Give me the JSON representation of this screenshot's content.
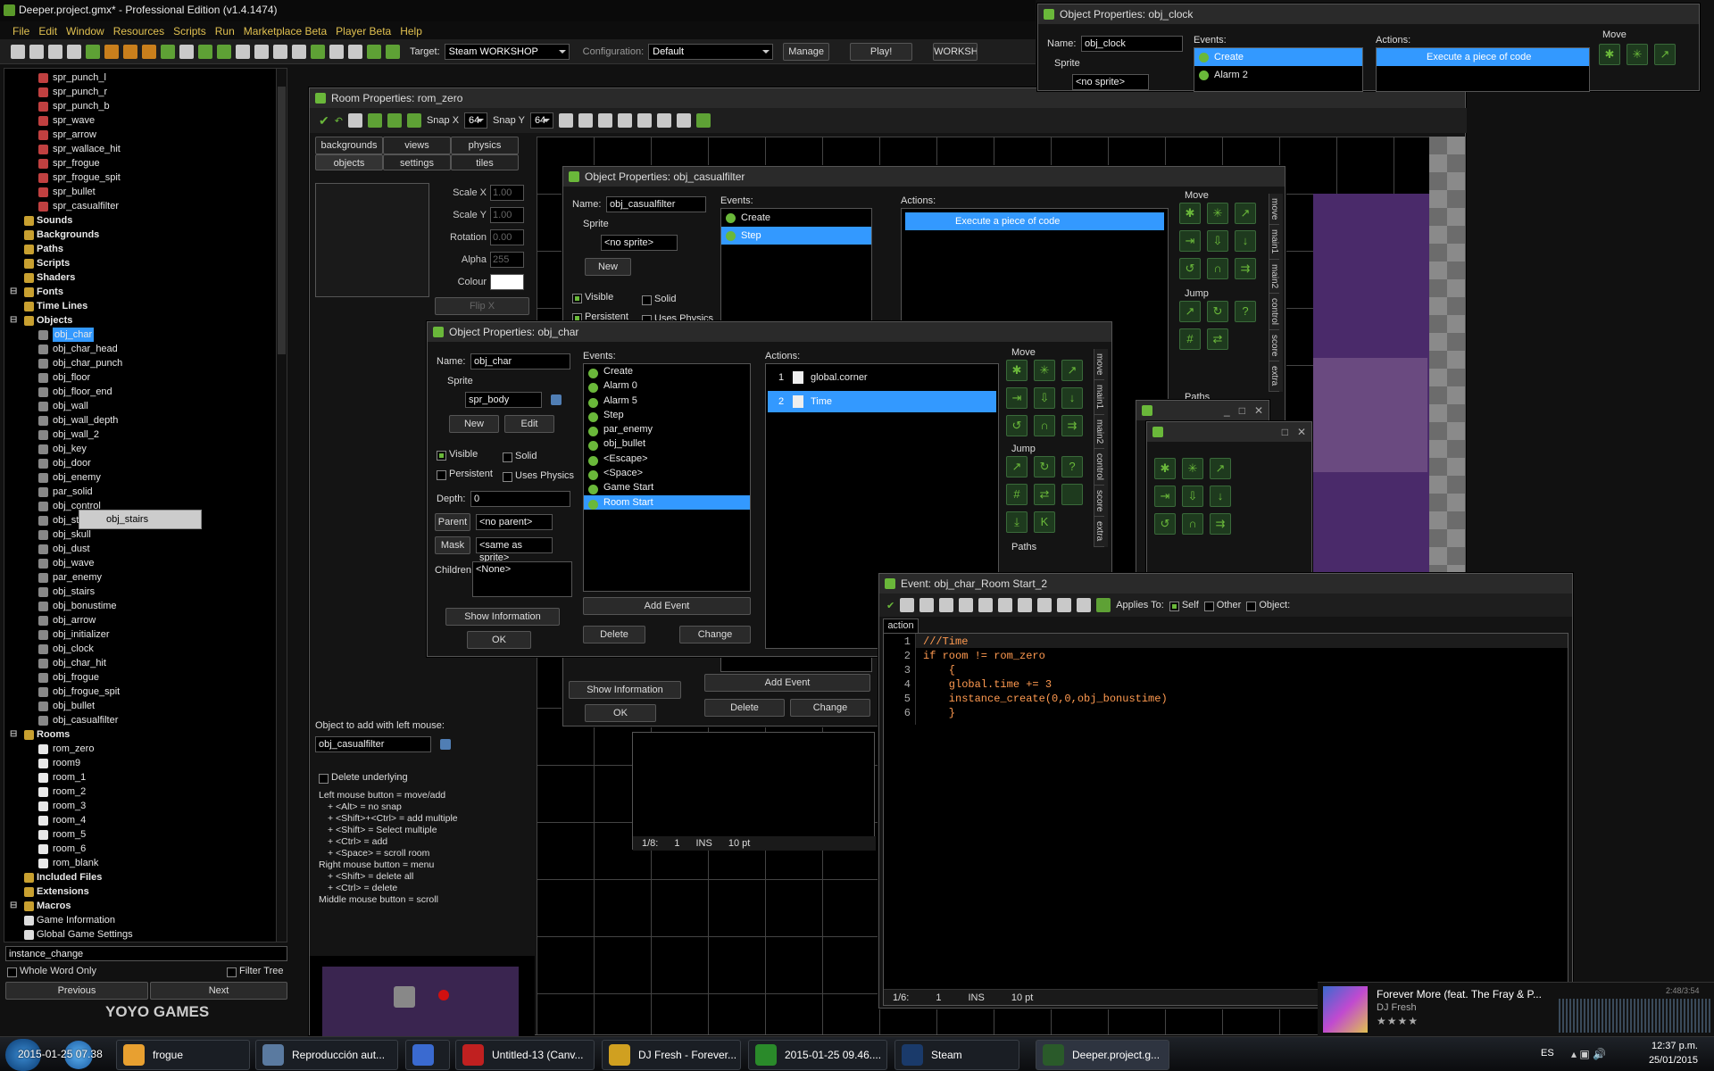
{
  "app": {
    "title": "Deeper.project.gmx* - Professional Edition (v1.4.1474)"
  },
  "menu": [
    "File",
    "Edit",
    "Window",
    "Resources",
    "Scripts",
    "Run",
    "Marketplace Beta",
    "Player Beta",
    "Help"
  ],
  "toolbar": {
    "target_label": "Target:",
    "target_value": "Steam WORKSHOP",
    "config_label": "Configuration:",
    "config_value": "Default",
    "manage": "Manage",
    "play": "Play!",
    "workshop": "WORKSHOP"
  },
  "tree": {
    "items": [
      {
        "name": "spr_punch_l",
        "type": "sprite",
        "indent": 2
      },
      {
        "name": "spr_punch_r",
        "type": "sprite",
        "indent": 2
      },
      {
        "name": "spr_punch_b",
        "type": "sprite",
        "indent": 2
      },
      {
        "name": "spr_wave",
        "type": "sprite",
        "indent": 2
      },
      {
        "name": "spr_arrow",
        "type": "sprite",
        "indent": 2
      },
      {
        "name": "spr_wallace_hit",
        "type": "sprite",
        "indent": 2
      },
      {
        "name": "spr_frogue",
        "type": "sprite",
        "indent": 2
      },
      {
        "name": "spr_frogue_spit",
        "type": "sprite",
        "indent": 2
      },
      {
        "name": "spr_bullet",
        "type": "sprite",
        "indent": 2
      },
      {
        "name": "spr_casualfilter",
        "type": "sprite",
        "indent": 2
      },
      {
        "name": "Sounds",
        "type": "folder",
        "indent": 1
      },
      {
        "name": "Backgrounds",
        "type": "folder",
        "indent": 1
      },
      {
        "name": "Paths",
        "type": "folder",
        "indent": 1
      },
      {
        "name": "Scripts",
        "type": "folder",
        "indent": 1
      },
      {
        "name": "Shaders",
        "type": "folder",
        "indent": 1
      },
      {
        "name": "Fonts",
        "type": "folder",
        "indent": 1
      },
      {
        "name": "Time Lines",
        "type": "folder",
        "indent": 1
      },
      {
        "name": "Objects",
        "type": "folder",
        "indent": 1
      },
      {
        "name": "obj_char",
        "type": "object",
        "indent": 2,
        "selected": true
      },
      {
        "name": "obj_char_head",
        "type": "object",
        "indent": 2
      },
      {
        "name": "obj_char_punch",
        "type": "object",
        "indent": 2
      },
      {
        "name": "obj_floor",
        "type": "object",
        "indent": 2
      },
      {
        "name": "obj_floor_end",
        "type": "object",
        "indent": 2
      },
      {
        "name": "obj_wall",
        "type": "object",
        "indent": 2
      },
      {
        "name": "obj_wall_depth",
        "type": "object",
        "indent": 2
      },
      {
        "name": "obj_wall_2",
        "type": "object",
        "indent": 2
      },
      {
        "name": "obj_key",
        "type": "object",
        "indent": 2
      },
      {
        "name": "obj_door",
        "type": "object",
        "indent": 2
      },
      {
        "name": "obj_enemy",
        "type": "object",
        "indent": 2
      },
      {
        "name": "par_solid",
        "type": "object",
        "indent": 2
      },
      {
        "name": "obj_control",
        "type": "object",
        "indent": 2
      },
      {
        "name": "obj_stairs",
        "type": "object",
        "indent": 2
      },
      {
        "name": "obj_skull",
        "type": "object",
        "indent": 2
      },
      {
        "name": "obj_dust",
        "type": "object",
        "indent": 2
      },
      {
        "name": "obj_wave",
        "type": "object",
        "indent": 2
      },
      {
        "name": "par_enemy",
        "type": "object",
        "indent": 2
      },
      {
        "name": "obj_stairs",
        "type": "object",
        "indent": 2
      },
      {
        "name": "obj_bonustime",
        "type": "object",
        "indent": 2
      },
      {
        "name": "obj_arrow",
        "type": "object",
        "indent": 2
      },
      {
        "name": "obj_initializer",
        "type": "object",
        "indent": 2
      },
      {
        "name": "obj_clock",
        "type": "object",
        "indent": 2
      },
      {
        "name": "obj_char_hit",
        "type": "object",
        "indent": 2
      },
      {
        "name": "obj_frogue",
        "type": "object",
        "indent": 2
      },
      {
        "name": "obj_frogue_spit",
        "type": "object",
        "indent": 2
      },
      {
        "name": "obj_bullet",
        "type": "object",
        "indent": 2
      },
      {
        "name": "obj_casualfilter",
        "type": "object",
        "indent": 2
      },
      {
        "name": "Rooms",
        "type": "folder",
        "indent": 1
      },
      {
        "name": "rom_zero",
        "type": "room",
        "indent": 2
      },
      {
        "name": "room9",
        "type": "room",
        "indent": 2
      },
      {
        "name": "room_1",
        "type": "room",
        "indent": 2
      },
      {
        "name": "room_2",
        "type": "room",
        "indent": 2
      },
      {
        "name": "room_3",
        "type": "room",
        "indent": 2
      },
      {
        "name": "room_4",
        "type": "room",
        "indent": 2
      },
      {
        "name": "room_5",
        "type": "room",
        "indent": 2
      },
      {
        "name": "room_6",
        "type": "room",
        "indent": 2
      },
      {
        "name": "rom_blank",
        "type": "room",
        "indent": 2
      },
      {
        "name": "Included Files",
        "type": "folder",
        "indent": 1
      },
      {
        "name": "Extensions",
        "type": "folder",
        "indent": 1
      },
      {
        "name": "Macros",
        "type": "folder",
        "indent": 1
      },
      {
        "name": "Game Information",
        "type": "doc",
        "indent": 1
      },
      {
        "name": "Global Game Settings",
        "type": "doc",
        "indent": 1
      }
    ],
    "drag_tooltip": "obj_stairs"
  },
  "search": {
    "value": "instance_change",
    "whole_word": "Whole Word Only",
    "filter": "Filter Tree",
    "prev": "Previous",
    "next": "Next"
  },
  "yoyo": "YOYO GAMES",
  "room": {
    "title": "Room Properties: rom_zero",
    "snapx_label": "Snap X",
    "snapx": "64",
    "snapy_label": "Snap Y",
    "snapy": "64",
    "tabs_top": [
      "backgrounds",
      "views",
      "physics"
    ],
    "tabs_bottom": [
      "objects",
      "settings",
      "tiles"
    ],
    "props": [
      {
        "label": "Scale X",
        "value": "1.00"
      },
      {
        "label": "Scale Y",
        "value": "1.00"
      },
      {
        "label": "Rotation",
        "value": "0.00"
      },
      {
        "label": "Alpha",
        "value": "255"
      },
      {
        "label": "Colour",
        "value": ""
      }
    ],
    "flipx": "Flip X",
    "obj_label": "Object to add with left mouse:",
    "obj_value": "obj_casualfilter",
    "delete_under": "Delete underlying",
    "help": [
      "Left mouse button = move/add",
      "+ <Alt> = no snap",
      "+ <Shift>+<Ctrl> = add multiple",
      "+ <Shift> = Select multiple",
      "+ <Ctrl> = add",
      "+ <Space> = scroll room",
      "Right mouse button = menu",
      "+ <Shift> = delete all",
      "+ <Ctrl> = delete",
      "Middle mouse button = scroll"
    ]
  },
  "clock": {
    "title": "Object Properties: obj_clock",
    "name_label": "Name:",
    "name": "obj_clock",
    "sprite_label": "Sprite",
    "sprite": "<no sprite>",
    "events_label": "Events:",
    "events": [
      "Create",
      "Alarm 2"
    ],
    "actions_label": "Actions:",
    "action": "Execute a piece of code",
    "move": "Move"
  },
  "casual": {
    "title": "Object Properties: obj_casualfilter",
    "name_label": "Name:",
    "name": "obj_casualfilter",
    "sprite_label": "Sprite",
    "sprite": "<no sprite>",
    "new": "New",
    "visible": "Visible",
    "solid": "Solid",
    "persistent": "Persistent",
    "physics": "Uses Physics",
    "events_label": "Events:",
    "events": [
      "Create",
      "Step"
    ],
    "actions_label": "Actions:",
    "action": "Execute a piece of code",
    "move": "Move",
    "jump": "Jump",
    "paths": "Paths",
    "tabs": [
      "move",
      "main1",
      "main2",
      "control",
      "score",
      "extra"
    ],
    "show_info": "Show Information",
    "ok": "OK",
    "add_event": "Add Event",
    "delete": "Delete",
    "change": "Change"
  },
  "char": {
    "title": "Object Properties: obj_char",
    "name_label": "Name:",
    "name": "obj_char",
    "sprite_label": "Sprite",
    "sprite": "spr_body",
    "new": "New",
    "edit": "Edit",
    "visible": "Visible",
    "solid": "Solid",
    "persistent": "Persistent",
    "physics": "Uses Physics",
    "depth_label": "Depth:",
    "depth": "0",
    "parent_label": "Parent",
    "parent": "<no parent>",
    "mask_label": "Mask",
    "mask": "<same as sprite>",
    "children_label": "Children:",
    "children": "<None>",
    "show_info": "Show Information",
    "ok": "OK",
    "events_label": "Events:",
    "events": [
      "Create",
      "Alarm 0",
      "Alarm 5",
      "Step",
      "par_enemy",
      "obj_bullet",
      "<Escape>",
      "<Space>",
      "Game Start",
      "Room Start"
    ],
    "add_event": "Add Event",
    "delete": "Delete",
    "change": "Change",
    "actions_label": "Actions:",
    "actions": [
      {
        "num": "1",
        "text": "global.corner"
      },
      {
        "num": "2",
        "text": "Time"
      }
    ],
    "move": "Move",
    "jump": "Jump",
    "paths": "Paths",
    "tabs": [
      "move",
      "main1",
      "main2",
      "control",
      "score",
      "extra"
    ]
  },
  "event": {
    "title": "Event: obj_char_Room Start_2",
    "applies": "Applies To:",
    "self": "Self",
    "other": "Other",
    "object": "Object:",
    "tab": "action",
    "code": [
      "///Time",
      "if room != rom_zero",
      "    {",
      "    global.time += 3",
      "    instance_create(0,0,obj_bonustime)",
      "    }"
    ],
    "status": {
      "pos": "1/6:",
      "col": "1",
      "mode": "INS",
      "size": "10 pt"
    }
  },
  "bg_status": {
    "pos": "1/8:",
    "col": "1",
    "mode": "INS",
    "size": "10 pt"
  },
  "music": {
    "title": "Forever More (feat. The Fray & P...",
    "artist": "DJ Fresh",
    "time": "2:48/3:54"
  },
  "taskbar": {
    "items": [
      "frogue",
      "Reproducción aut...",
      "",
      "Untitled-13 (Canv...",
      "DJ Fresh - Forever...",
      "2015-01-25 09.46....",
      "Steam",
      "Deeper.project.g..."
    ],
    "lang": "ES",
    "time": "12:37 p.m.",
    "date": "25/01/2015",
    "overlay": "2015-01-25 07.38"
  },
  "colors": {
    "accent": "#3399ff",
    "green": "#6ab83a",
    "purple": "#4a2a6a"
  }
}
